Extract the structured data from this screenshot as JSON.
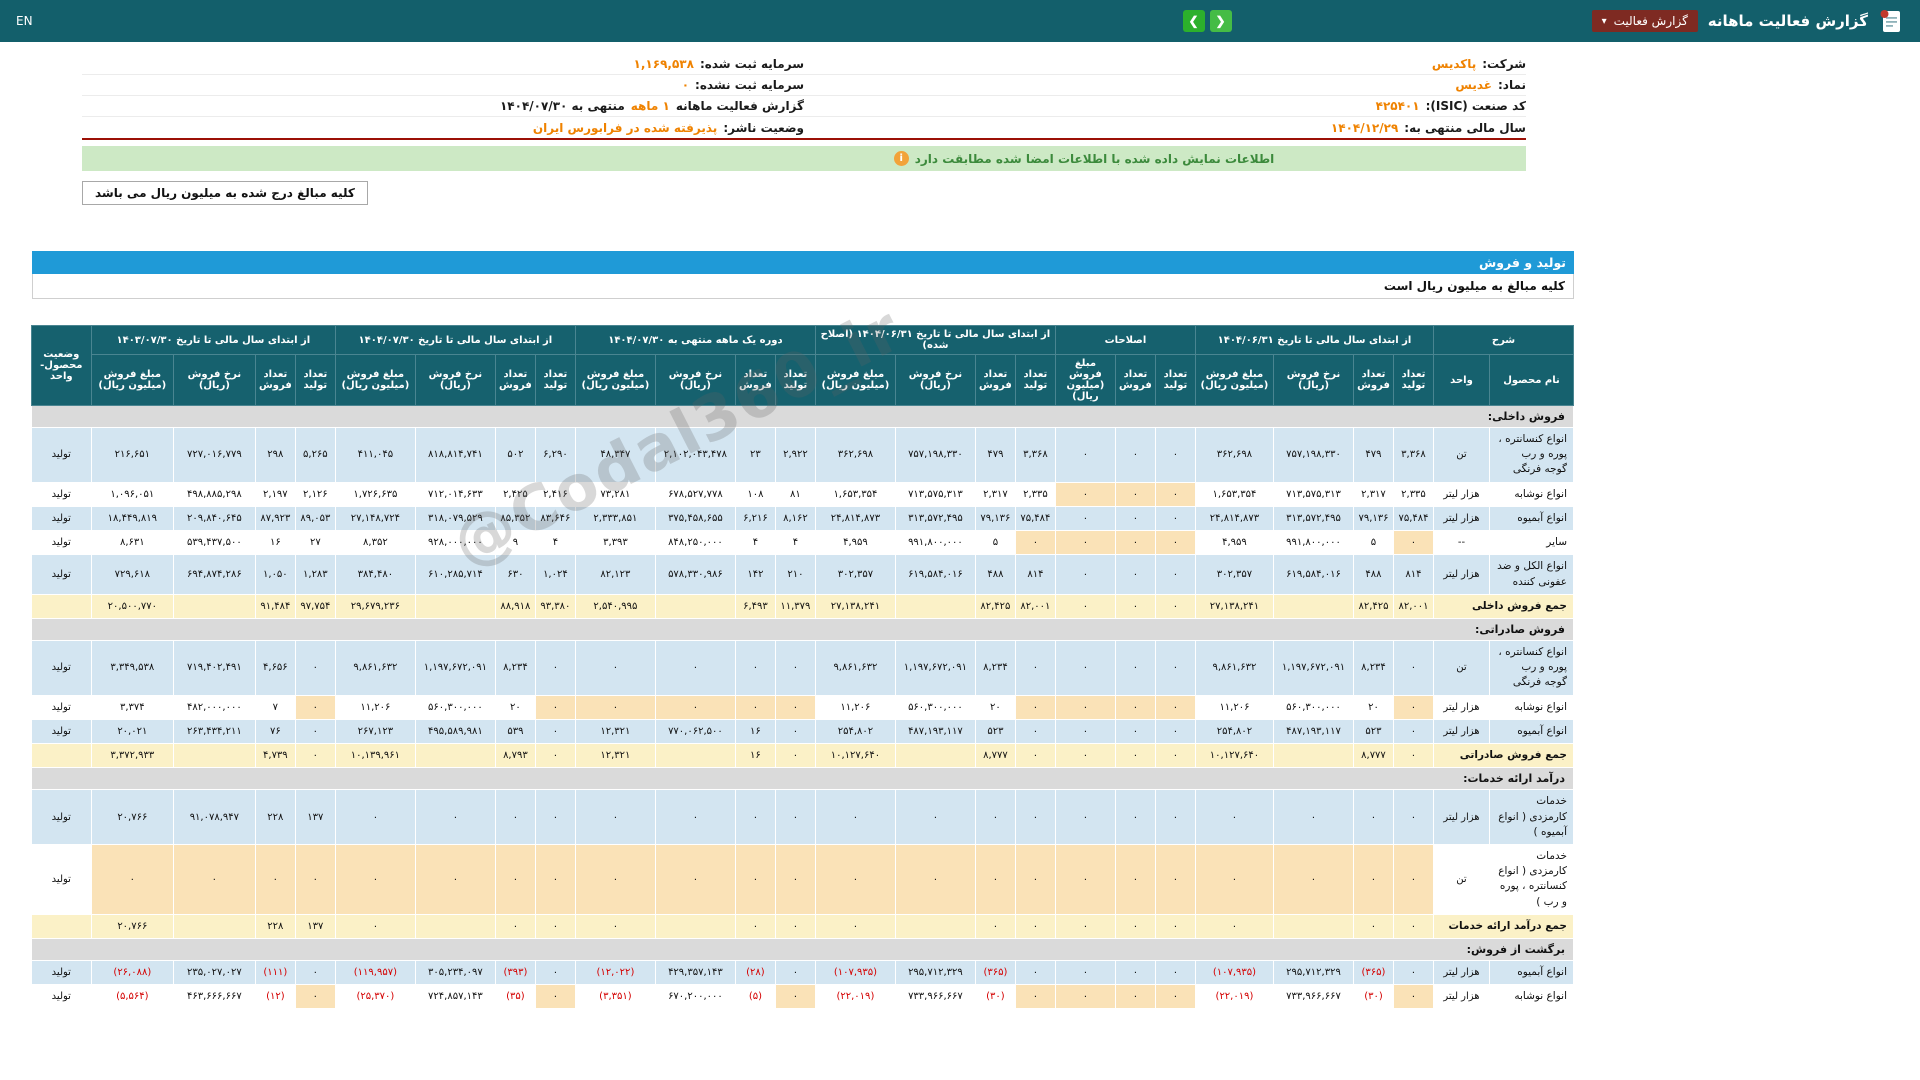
{
  "topbar": {
    "title": "گزارش فعالیت ماهانه",
    "dropdown_label": "گزارش فعالیت",
    "en_label": "EN"
  },
  "icons": {
    "dropdown_caret": "▾",
    "nav_left": "❮",
    "nav_right": "❯",
    "info_glyph": "i"
  },
  "info": {
    "rows": [
      {
        "right_label": "شرکت:",
        "right_value": "پاکدیس",
        "left_label": "سرمایه ثبت شده:",
        "left_value": "۱,۱۶۹,۵۳۸"
      },
      {
        "right_label": "نماد:",
        "right_value": "غدیس",
        "left_label": "سرمایه ثبت نشده:",
        "left_value": "۰"
      },
      {
        "right_label": "کد صنعت (ISIC):",
        "right_value": "۴۲۵۴۰۱",
        "left_label": "گزارش فعالیت ماهانه",
        "left_value": "۱ ماهه",
        "left_suffix": "منتهی به ۱۴۰۴/۰۷/۳۰"
      },
      {
        "right_label": "سال مالی منتهی به:",
        "right_value": "۱۴۰۴/۱۲/۲۹",
        "left_label": "وضعیت ناشر:",
        "left_value": "پذیرفته شده در فرابورس ایران"
      }
    ]
  },
  "banner": {
    "text": "اطلاعات نمایش داده شده با اطلاعات امضا شده مطابقت دارد"
  },
  "note_box": "کلیه مبالغ درج شده به میلیون ریال می باشد",
  "section_bar": "تولید و فروش",
  "amounts_note": "کلیه مبالغ به میلیون ریال است",
  "watermark": "@Codal360_ir",
  "table": {
    "desc_header": "شرح",
    "product_header": "نام محصول",
    "unit_header": "واحد",
    "status_header": "وضعیت محصول-واحد",
    "groups": [
      {
        "title": "از ابتدای سال مالی تا تاریخ ۱۴۰۴/۰۶/۳۱",
        "cols": [
          "تعداد تولید",
          "تعداد فروش",
          "نرخ فروش (ریال)",
          "مبلغ فروش (میلیون ریال)"
        ]
      },
      {
        "title": "اصلاحات",
        "cols": [
          "تعداد تولید",
          "تعداد فروش",
          "مبلغ فروش (میلیون ریال)"
        ]
      },
      {
        "title": "از ابتدای سال مالی تا تاریخ ۱۴۰۴/۰۶/۳۱ (اصلاح شده)",
        "cols": [
          "تعداد تولید",
          "تعداد فروش",
          "نرخ فروش (ریال)",
          "مبلغ فروش (میلیون ریال)"
        ]
      },
      {
        "title": "دوره یک ماهه منتهی به ۱۴۰۴/۰۷/۳۰",
        "cols": [
          "تعداد تولید",
          "تعداد فروش",
          "نرخ فروش (ریال)",
          "مبلغ فروش (میلیون ریال)"
        ]
      },
      {
        "title": "از ابتدای سال مالی تا تاریخ ۱۴۰۴/۰۷/۳۰",
        "cols": [
          "تعداد تولید",
          "تعداد فروش",
          "نرخ فروش (ریال)",
          "مبلغ فروش (میلیون ریال)"
        ]
      },
      {
        "title": "از ابتدای سال مالی تا تاریخ ۱۴۰۳/۰۷/۳۰",
        "cols": [
          "تعداد تولید",
          "تعداد فروش",
          "نرخ فروش (ریال)",
          "مبلغ فروش (میلیون ریال)"
        ]
      }
    ],
    "sections": [
      {
        "title": "فروش داخلی:",
        "rows": [
          {
            "name": "انواع کنسانتره ، پوره و رب گوجه فرنگی",
            "unit": "تن",
            "status": "تولید",
            "cells": [
              "۳,۳۶۸",
              "۴۷۹",
              "۷۵۷,۱۹۸,۳۳۰",
              "۳۶۲,۶۹۸",
              "۰",
              "۰",
              "۰",
              "۳,۳۶۸",
              "۴۷۹",
              "۷۵۷,۱۹۸,۳۳۰",
              "۳۶۲,۶۹۸",
              "۲,۹۲۲",
              "۲۳",
              "۲,۱۰۲,۰۴۳,۴۷۸",
              "۴۸,۳۴۷",
              "۶,۲۹۰",
              "۵۰۲",
              "۸۱۸,۸۱۴,۷۴۱",
              "۴۱۱,۰۴۵",
              "۵,۲۶۵",
              "۲۹۸",
              "۷۲۷,۰۱۶,۷۷۹",
              "۲۱۶,۶۵۱"
            ]
          },
          {
            "name": "انواع نوشابه",
            "unit": "هزار لیتر",
            "status": "تولید",
            "cells": [
              "۲,۳۳۵",
              "۲,۳۱۷",
              "۷۱۳,۵۷۵,۳۱۳",
              "۱,۶۵۳,۳۵۴",
              "۰",
              "۰",
              "۰",
              "۲,۳۳۵",
              "۲,۳۱۷",
              "۷۱۳,۵۷۵,۳۱۳",
              "۱,۶۵۳,۳۵۴",
              "۸۱",
              "۱۰۸",
              "۶۷۸,۵۲۷,۷۷۸",
              "۷۳,۲۸۱",
              "۲,۴۱۶",
              "۲,۴۲۵",
              "۷۱۲,۰۱۴,۶۳۳",
              "۱,۷۲۶,۶۳۵",
              "۲,۱۲۶",
              "۲,۱۹۷",
              "۴۹۸,۸۸۵,۲۹۸",
              "۱,۰۹۶,۰۵۱"
            ]
          },
          {
            "name": "انواع آبمیوه",
            "unit": "هزار لیتر",
            "status": "تولید",
            "cells": [
              "۷۵,۴۸۴",
              "۷۹,۱۳۶",
              "۳۱۳,۵۷۲,۴۹۵",
              "۲۴,۸۱۴,۸۷۳",
              "۰",
              "۰",
              "۰",
              "۷۵,۴۸۴",
              "۷۹,۱۳۶",
              "۳۱۳,۵۷۲,۴۹۵",
              "۲۴,۸۱۴,۸۷۳",
              "۸,۱۶۲",
              "۶,۲۱۶",
              "۳۷۵,۴۵۸,۶۵۵",
              "۲,۳۳۳,۸۵۱",
              "۸۳,۶۴۶",
              "۸۵,۳۵۲",
              "۳۱۸,۰۷۹,۵۲۹",
              "۲۷,۱۴۸,۷۲۴",
              "۸۹,۰۵۳",
              "۸۷,۹۲۳",
              "۲۰۹,۸۴۰,۶۴۵",
              "۱۸,۴۴۹,۸۱۹"
            ]
          },
          {
            "name": "سایر",
            "unit": "--",
            "status": "تولید",
            "cells": [
              "۰",
              "۵",
              "۹۹۱,۸۰۰,۰۰۰",
              "۴,۹۵۹",
              "۰",
              "۰",
              "۰",
              "۰",
              "۵",
              "۹۹۱,۸۰۰,۰۰۰",
              "۴,۹۵۹",
              "۴",
              "۴",
              "۸۴۸,۲۵۰,۰۰۰",
              "۳,۳۹۳",
              "۴",
              "۹",
              "۹۲۸,۰۰۰,۰۰۰",
              "۸,۳۵۲",
              "۲۷",
              "۱۶",
              "۵۳۹,۴۳۷,۵۰۰",
              "۸,۶۳۱"
            ]
          },
          {
            "name": "انواع الکل و ضد عفونی کننده",
            "unit": "هزار لیتر",
            "status": "تولید",
            "cells": [
              "۸۱۴",
              "۴۸۸",
              "۶۱۹,۵۸۴,۰۱۶",
              "۳۰۲,۳۵۷",
              "۰",
              "۰",
              "۰",
              "۸۱۴",
              "۴۸۸",
              "۶۱۹,۵۸۴,۰۱۶",
              "۳۰۲,۳۵۷",
              "۲۱۰",
              "۱۴۲",
              "۵۷۸,۳۳۰,۹۸۶",
              "۸۲,۱۲۳",
              "۱,۰۲۴",
              "۶۳۰",
              "۶۱۰,۲۸۵,۷۱۴",
              "۳۸۴,۴۸۰",
              "۱,۲۸۳",
              "۱,۰۵۰",
              "۶۹۴,۸۷۴,۲۸۶",
              "۷۲۹,۶۱۸"
            ]
          }
        ],
        "summary": {
          "name": "جمع فروش داخلی",
          "cells": [
            "۸۲,۰۰۱",
            "۸۲,۴۲۵",
            "",
            "۲۷,۱۳۸,۲۴۱",
            "۰",
            "۰",
            "۰",
            "۸۲,۰۰۱",
            "۸۲,۴۲۵",
            "",
            "۲۷,۱۳۸,۲۴۱",
            "۱۱,۳۷۹",
            "۶,۴۹۳",
            "",
            "۲,۵۴۰,۹۹۵",
            "۹۳,۳۸۰",
            "۸۸,۹۱۸",
            "",
            "۲۹,۶۷۹,۲۳۶",
            "۹۷,۷۵۴",
            "۹۱,۴۸۴",
            "",
            "۲۰,۵۰۰,۷۷۰"
          ]
        }
      },
      {
        "title": "فروش صادراتی:",
        "rows": [
          {
            "name": "انواع کنسانتره ، پوره و رب گوجه فرنگی",
            "unit": "تن",
            "status": "تولید",
            "cells": [
              "۰",
              "۸,۲۳۴",
              "۱,۱۹۷,۶۷۲,۰۹۱",
              "۹,۸۶۱,۶۳۲",
              "۰",
              "۰",
              "۰",
              "۰",
              "۸,۲۳۴",
              "۱,۱۹۷,۶۷۲,۰۹۱",
              "۹,۸۶۱,۶۳۲",
              "۰",
              "۰",
              "۰",
              "۰",
              "۰",
              "۸,۲۳۴",
              "۱,۱۹۷,۶۷۲,۰۹۱",
              "۹,۸۶۱,۶۳۲",
              "۰",
              "۴,۶۵۶",
              "۷۱۹,۴۰۲,۴۹۱",
              "۳,۳۴۹,۵۳۸"
            ]
          },
          {
            "name": "انواع نوشابه",
            "unit": "هزار لیتر",
            "status": "تولید",
            "cells": [
              "۰",
              "۲۰",
              "۵۶۰,۳۰۰,۰۰۰",
              "۱۱,۲۰۶",
              "۰",
              "۰",
              "۰",
              "۰",
              "۲۰",
              "۵۶۰,۳۰۰,۰۰۰",
              "۱۱,۲۰۶",
              "۰",
              "۰",
              "۰",
              "۰",
              "۰",
              "۲۰",
              "۵۶۰,۳۰۰,۰۰۰",
              "۱۱,۲۰۶",
              "۰",
              "۷",
              "۴۸۲,۰۰۰,۰۰۰",
              "۳,۳۷۴"
            ]
          },
          {
            "name": "انواع آبمیوه",
            "unit": "هزار لیتر",
            "status": "تولید",
            "cells": [
              "۰",
              "۵۲۳",
              "۴۸۷,۱۹۳,۱۱۷",
              "۲۵۴,۸۰۲",
              "۰",
              "۰",
              "۰",
              "۰",
              "۵۲۳",
              "۴۸۷,۱۹۳,۱۱۷",
              "۲۵۴,۸۰۲",
              "۰",
              "۱۶",
              "۷۷۰,۰۶۲,۵۰۰",
              "۱۲,۳۲۱",
              "۰",
              "۵۳۹",
              "۴۹۵,۵۸۹,۹۸۱",
              "۲۶۷,۱۲۳",
              "۰",
              "۷۶",
              "۲۶۳,۴۳۴,۲۱۱",
              "۲۰,۰۲۱"
            ]
          }
        ],
        "summary": {
          "name": "جمع فروش صادراتی",
          "cells": [
            "۰",
            "۸,۷۷۷",
            "",
            "۱۰,۱۲۷,۶۴۰",
            "۰",
            "۰",
            "۰",
            "۰",
            "۸,۷۷۷",
            "",
            "۱۰,۱۲۷,۶۴۰",
            "۰",
            "۱۶",
            "",
            "۱۲,۳۲۱",
            "۰",
            "۸,۷۹۳",
            "",
            "۱۰,۱۳۹,۹۶۱",
            "۰",
            "۴,۷۳۹",
            "",
            "۳,۳۷۲,۹۳۳"
          ]
        }
      },
      {
        "title": "درآمد ارائه خدمات:",
        "rows": [
          {
            "name": "خدمات کارمزدی ( انواع آبمیوه )",
            "unit": "هزار لیتر",
            "status": "تولید",
            "cells": [
              "۰",
              "۰",
              "۰",
              "۰",
              "۰",
              "۰",
              "۰",
              "۰",
              "۰",
              "۰",
              "۰",
              "۰",
              "۰",
              "۰",
              "۰",
              "۰",
              "۰",
              "۰",
              "۰",
              "۱۳۷",
              "۲۲۸",
              "۹۱,۰۷۸,۹۴۷",
              "۲۰,۷۶۶"
            ]
          },
          {
            "name": "خدمات کارمزدی ( انواع کنسانتره ، پوره و رب )",
            "unit": "تن",
            "status": "تولید",
            "cells": [
              "۰",
              "۰",
              "۰",
              "۰",
              "۰",
              "۰",
              "۰",
              "۰",
              "۰",
              "۰",
              "۰",
              "۰",
              "۰",
              "۰",
              "۰",
              "۰",
              "۰",
              "۰",
              "۰",
              "۰",
              "۰",
              "۰",
              "۰"
            ]
          }
        ],
        "summary": {
          "name": "جمع درآمد ارائه خدمات",
          "cells": [
            "۰",
            "۰",
            "",
            "۰",
            "۰",
            "۰",
            "۰",
            "۰",
            "۰",
            "",
            "۰",
            "۰",
            "۰",
            "",
            "۰",
            "۰",
            "۰",
            "",
            "۰",
            "۱۳۷",
            "۲۲۸",
            "",
            "۲۰,۷۶۶"
          ]
        }
      },
      {
        "title": "برگشت از فروش:",
        "rows": [
          {
            "name": "انواع آبمیوه",
            "unit": "هزار لیتر",
            "status": "تولید",
            "cells": [
              "۰",
              "(۳۶۵)",
              "۲۹۵,۷۱۲,۳۲۹",
              "(۱۰۷,۹۳۵)",
              "۰",
              "۰",
              "۰",
              "۰",
              "(۳۶۵)",
              "۲۹۵,۷۱۲,۳۲۹",
              "(۱۰۷,۹۳۵)",
              "۰",
              "(۲۸)",
              "۴۲۹,۳۵۷,۱۴۳",
              "(۱۲,۰۲۲)",
              "۰",
              "(۳۹۳)",
              "۳۰۵,۲۳۴,۰۹۷",
              "(۱۱۹,۹۵۷)",
              "۰",
              "(۱۱۱)",
              "۲۳۵,۰۲۷,۰۲۷",
              "(۲۶,۰۸۸)"
            ]
          },
          {
            "name": "انواع نوشابه",
            "unit": "هزار لیتر",
            "status": "تولید",
            "cells": [
              "۰",
              "(۳۰)",
              "۷۳۳,۹۶۶,۶۶۷",
              "(۲۲,۰۱۹)",
              "۰",
              "۰",
              "۰",
              "۰",
              "(۳۰)",
              "۷۳۳,۹۶۶,۶۶۷",
              "(۲۲,۰۱۹)",
              "۰",
              "(۵)",
              "۶۷۰,۲۰۰,۰۰۰",
              "(۳,۳۵۱)",
              "۰",
              "(۳۵)",
              "۷۲۴,۸۵۷,۱۴۳",
              "(۲۵,۳۷۰)",
              "۰",
              "(۱۲)",
              "۴۶۳,۶۶۶,۶۶۷",
              "(۵,۵۶۴)"
            ]
          }
        ]
      }
    ]
  }
}
